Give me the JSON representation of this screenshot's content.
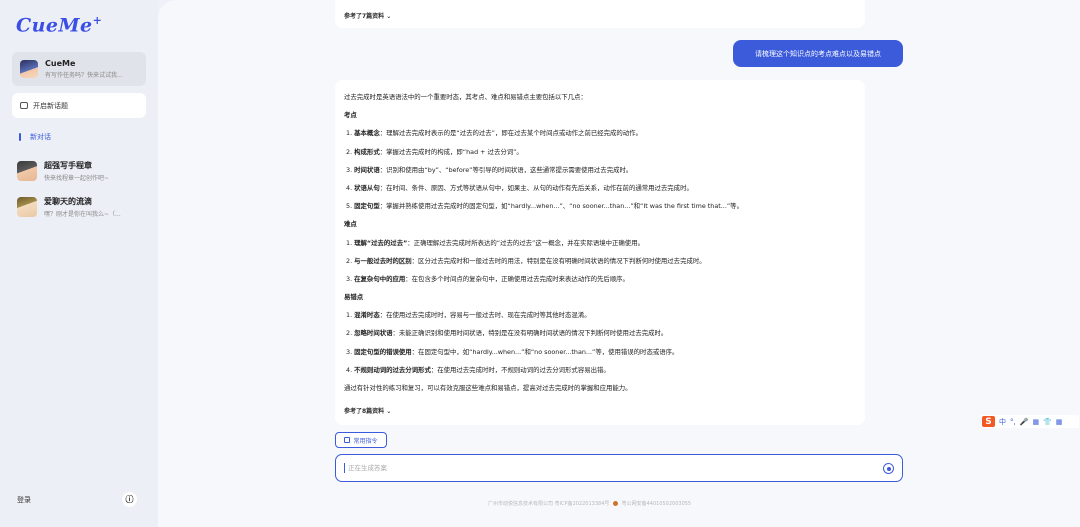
{
  "app": {
    "logo": "CueMe",
    "logo_plus": "+"
  },
  "sidebar": {
    "current_bot": {
      "name": "CueMe",
      "subtitle": "有写作任务吗？快来试试我..."
    },
    "new_topic_label": "开启新话题",
    "new_chat_label": "新对话",
    "bots": [
      {
        "name": "超强写手程章",
        "subtitle": "快来找程章一起创作吧~"
      },
      {
        "name": "爱聊天的流滴",
        "subtitle": "嘿？刚才是你在叫我么~（..."
      }
    ],
    "login_label": "登录",
    "info_icon": "ⓘ"
  },
  "chat": {
    "top_ref_label": "参考了7篇资料",
    "user_message": "请梳理这个知识点的考点难点以及易错点",
    "answer_intro": "过去完成时是英语语法中的一个重要时态，其考点、难点和易错点主要包括以下几点：",
    "sections": [
      {
        "heading": "考点",
        "items": [
          {
            "num": "1.",
            "term": "基本概念",
            "text": "：理解过去完成时表示的是“过去的过去”，即在过去某个时间点或动作之前已经完成的动作。"
          },
          {
            "num": "2.",
            "term": "构成形式",
            "text": "：掌握过去完成时的构成，即“had + 过去分词”。"
          },
          {
            "num": "3.",
            "term": "时间状语",
            "text": "：识别和使用由“by”、“before”等引导的时间状语，这些通常提示需要使用过去完成时。"
          },
          {
            "num": "4.",
            "term": "状语从句",
            "text": "：在时间、条件、原因、方式等状语从句中，如果主、从句的动作有先后关系，动作在前的通常用过去完成时。"
          },
          {
            "num": "5.",
            "term": "固定句型",
            "text": "：掌握并熟练使用过去完成时的固定句型，如“hardly...when...”、“no sooner...than...”和“It was the first time that...”等。"
          }
        ]
      },
      {
        "heading": "难点",
        "items": [
          {
            "num": "1.",
            "term": "理解“过去的过去”",
            "text": "：正确理解过去完成时所表达的“过去的过去”这一概念，并在实际语境中正确使用。"
          },
          {
            "num": "2.",
            "term": "与一般过去时的区别",
            "text": "：区分过去完成时和一般过去时的用法，特别是在没有明确时间状语的情况下判断何时使用过去完成时。"
          },
          {
            "num": "3.",
            "term": "在复杂句中的应用",
            "text": "：在包含多个时间点的复杂句中，正确使用过去完成时来表达动作的先后顺序。"
          }
        ]
      },
      {
        "heading": "易错点",
        "items": [
          {
            "num": "1.",
            "term": "混淆时态",
            "text": "：在使用过去完成时时，容易与一般过去时、现在完成时等其他时态混淆。"
          },
          {
            "num": "2.",
            "term": "忽略时间状语",
            "text": "：未能正确识别和使用时间状语，特别是在没有明确时间状语的情况下判断何时使用过去完成时。"
          },
          {
            "num": "3.",
            "term": "固定句型的错误使用",
            "text": "：在固定句型中，如“hardly...when...”和“no sooner...than...”等，使用错误的时态或语序。"
          },
          {
            "num": "4.",
            "term": "不规则动词的过去分词形式",
            "text": "：在使用过去完成时时，不规则动词的过去分词形式容易出错。"
          }
        ]
      }
    ],
    "answer_outro": "通过有针对性的练习和复习，可以有效克服这些难点和易错点，提高对过去完成时的掌握和应用能力。",
    "bottom_ref_label": "参考了8篇资料",
    "chevron": "⌄",
    "command_button_label": "常用指令",
    "input_placeholder": "正在生成答案",
    "input_value": ""
  },
  "footer": {
    "company": "广州市动悦信息技术有限公司 粤ICP备2022013384号",
    "police": "粤公网安备44010502003055"
  },
  "ime": {
    "logo": "S",
    "items": [
      "中",
      "°,",
      "🎤",
      "▦",
      "👕",
      "▦"
    ]
  },
  "colors": {
    "accent": "#3b5bdb",
    "sidebar_bg": "#eceff6",
    "main_bg": "#f7f8fb"
  }
}
